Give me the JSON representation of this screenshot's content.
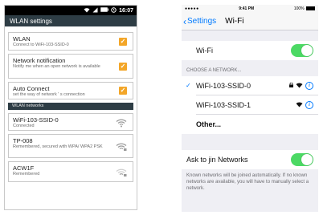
{
  "android": {
    "status_time": "16:07",
    "title": "WLAN settings",
    "items": [
      {
        "title": "WLAN",
        "subtitle": "Connect to WiFi-103-SSID-0",
        "checked": true
      },
      {
        "title": "Network notification",
        "subtitle": "Notify me when an open network is available",
        "checked": true
      },
      {
        "title": "Auto Connect",
        "subtitle": "set the way of network ' s connection",
        "checked": true
      }
    ],
    "section_label": "WLAN networks",
    "networks": [
      {
        "name": "WiFi-103-SSID-0",
        "status": "Connected"
      },
      {
        "name": "TP-008",
        "status": "Remembered, secured with WPA/ WPA2 PSK"
      },
      {
        "name": "ACW1F",
        "status": "Remembered"
      }
    ]
  },
  "ios": {
    "status_signal": "●●●●● ",
    "status_time": "9:41 PM",
    "status_battery": "100%",
    "back_label": "Settings",
    "title": "Wi-Fi",
    "wifi_label": "Wi-Fi",
    "wifi_on": true,
    "choose_header": "CHOOSE A NETWORK...",
    "networks": [
      {
        "name": "WiFi-103-SSID-0",
        "connected": true,
        "locked": true
      },
      {
        "name": "WiFi-103-SSID-1",
        "connected": false,
        "locked": false
      }
    ],
    "other_label": "Other...",
    "ask_label": "Ask to jin Networks",
    "ask_on": true,
    "footer": "Known networks will be joined automatically. If no known networks are available, you will have to manually select a network."
  },
  "colors": {
    "android_titlebar": "#2e3d45",
    "android_checkbox": "#f3a628",
    "ios_blue": "#007aff",
    "ios_green": "#4cd964"
  },
  "icons": [
    "wifi-icon",
    "signal-icon",
    "battery-icon",
    "lock-icon",
    "info-icon",
    "checkmark-icon",
    "chevron-left-icon"
  ]
}
